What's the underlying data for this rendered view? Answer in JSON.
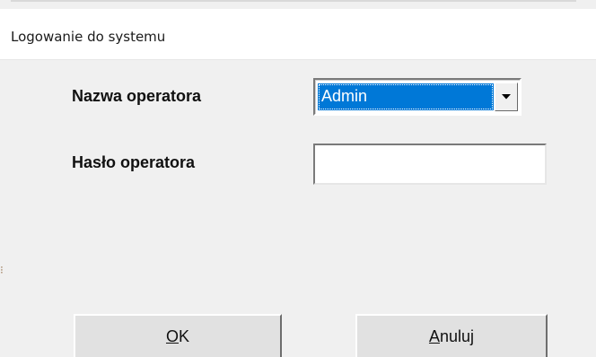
{
  "window": {
    "title": "Logowanie do systemu"
  },
  "form": {
    "operator_label": "Nazwa operatora",
    "operator_value": "Admin",
    "password_label": "Hasło operatora",
    "password_value": ""
  },
  "buttons": {
    "ok_accel": "O",
    "ok_rest": "K",
    "cancel_accel": "A",
    "cancel_rest": "nuluj"
  },
  "colors": {
    "selection": "#0078d7",
    "face": "#f0f0f0",
    "button_face": "#e1e1e1"
  },
  "icons": {
    "dropdown": "chevron-down-icon"
  }
}
